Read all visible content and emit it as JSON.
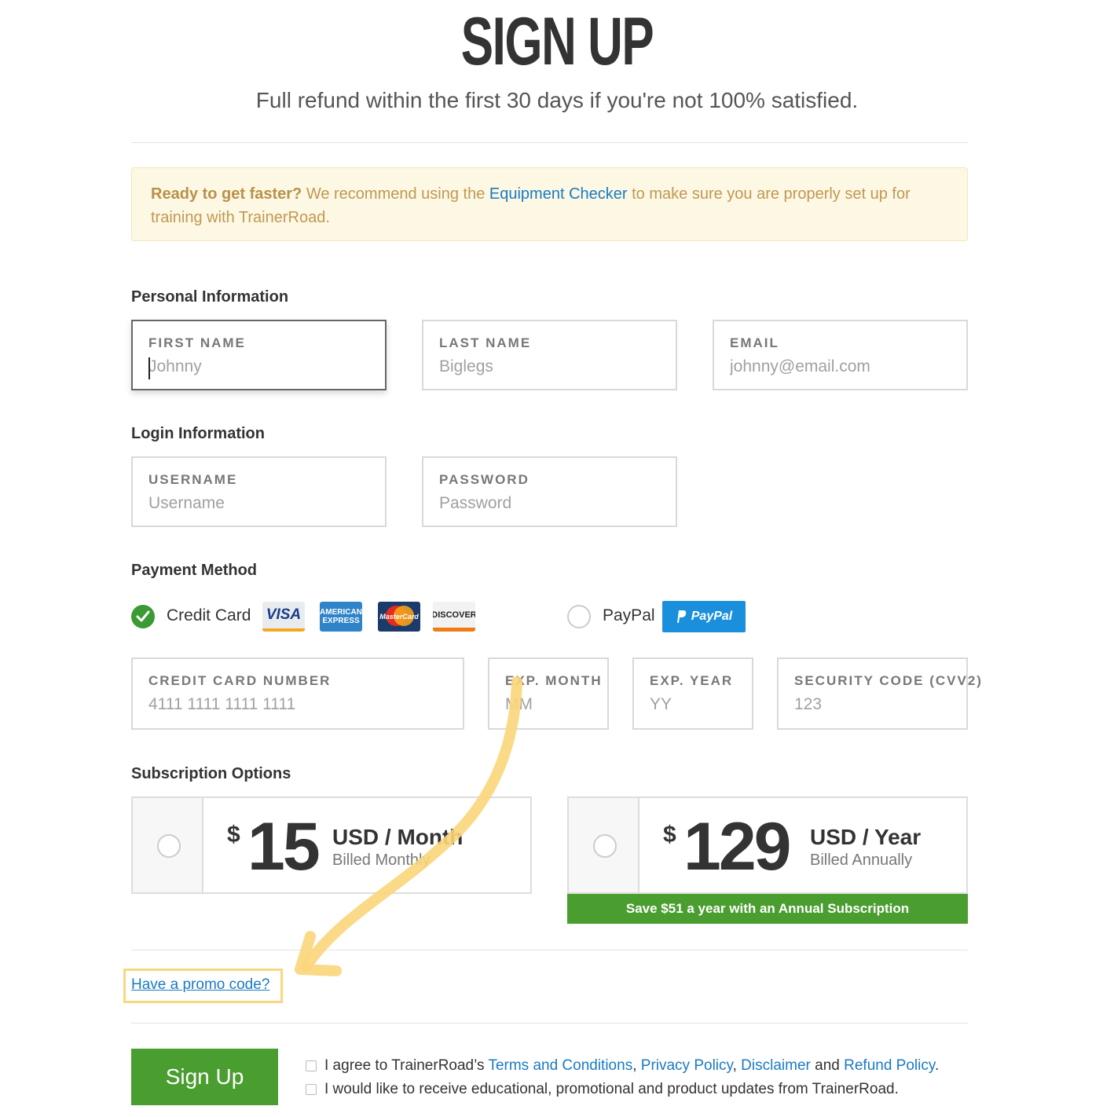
{
  "header": {
    "title": "SIGN UP",
    "subtitle": "Full refund within the first 30 days if you're not 100% satisfied."
  },
  "notice": {
    "bold": "Ready to get faster?",
    "text_before_link": " We recommend using the ",
    "link": "Equipment Checker",
    "text_after_link": " to make sure you are properly set up for training with TrainerRoad."
  },
  "personal": {
    "heading": "Personal Information",
    "first_name": {
      "label": "FIRST NAME",
      "placeholder": "Johnny"
    },
    "last_name": {
      "label": "LAST NAME",
      "placeholder": "Biglegs"
    },
    "email": {
      "label": "EMAIL",
      "placeholder": "johnny@email.com"
    }
  },
  "login": {
    "heading": "Login Information",
    "username": {
      "label": "USERNAME",
      "placeholder": "Username"
    },
    "password": {
      "label": "PASSWORD",
      "placeholder": "Password"
    }
  },
  "payment": {
    "heading": "Payment Method",
    "credit_card_label": "Credit Card",
    "paypal_label": "PayPal",
    "paypal_logo": "PayPal",
    "card_logos": {
      "visa": "VISA",
      "amex_top": "AMERICAN",
      "amex_bottom": "EXPRESS",
      "mastercard": "MasterCard",
      "discover": "DISCOVER"
    },
    "card_number": {
      "label": "CREDIT CARD NUMBER",
      "placeholder": "4111 1111 1111 1111"
    },
    "exp_month": {
      "label": "EXP. MONTH",
      "placeholder": "MM"
    },
    "exp_year": {
      "label": "EXP. YEAR",
      "placeholder": "YY"
    },
    "cvv": {
      "label": "SECURITY CODE (CVV2)",
      "placeholder": "123"
    }
  },
  "subscription": {
    "heading": "Subscription Options",
    "monthly": {
      "currency": "$",
      "amount": "15",
      "unit": "USD / Month",
      "billed": "Billed Monthly"
    },
    "yearly": {
      "currency": "$",
      "amount": "129",
      "unit": "USD / Year",
      "billed": "Billed Annually"
    },
    "save_banner": "Save $51 a year with an Annual Subscription"
  },
  "promo": {
    "link": "Have a promo code?"
  },
  "footer": {
    "signup_button": "Sign Up",
    "agree_prefix": "I agree to TrainerRoad’s ",
    "terms": "Terms and Conditions",
    "comma1": ", ",
    "privacy": "Privacy Policy",
    "comma2": ", ",
    "disclaimer": "Disclaimer",
    "and": " and ",
    "refund": "Refund Policy",
    "period": ".",
    "updates": "I would like to receive educational, promotional and product updates from TrainerRoad."
  },
  "colors": {
    "accent_green": "#4a9e2f",
    "link_blue": "#1a7ac5",
    "notice_bg": "#fcf8e3",
    "highlight_yellow": "#f9d77e"
  }
}
